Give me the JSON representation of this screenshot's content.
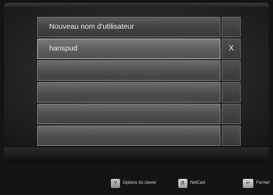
{
  "list": {
    "header": "Nouveau nom d'utilisateur",
    "rows": [
      {
        "label": "hanspud",
        "action": "X"
      },
      {
        "label": "",
        "action": ""
      },
      {
        "label": "",
        "action": ""
      },
      {
        "label": "",
        "action": ""
      },
      {
        "label": "",
        "action": ""
      }
    ]
  },
  "footer": {
    "options": {
      "key": "Y",
      "label": "Options du clavier"
    },
    "netcast": {
      "key": "B",
      "label": "NetCast"
    },
    "close": {
      "key": "↩",
      "label": "Fermer"
    }
  }
}
